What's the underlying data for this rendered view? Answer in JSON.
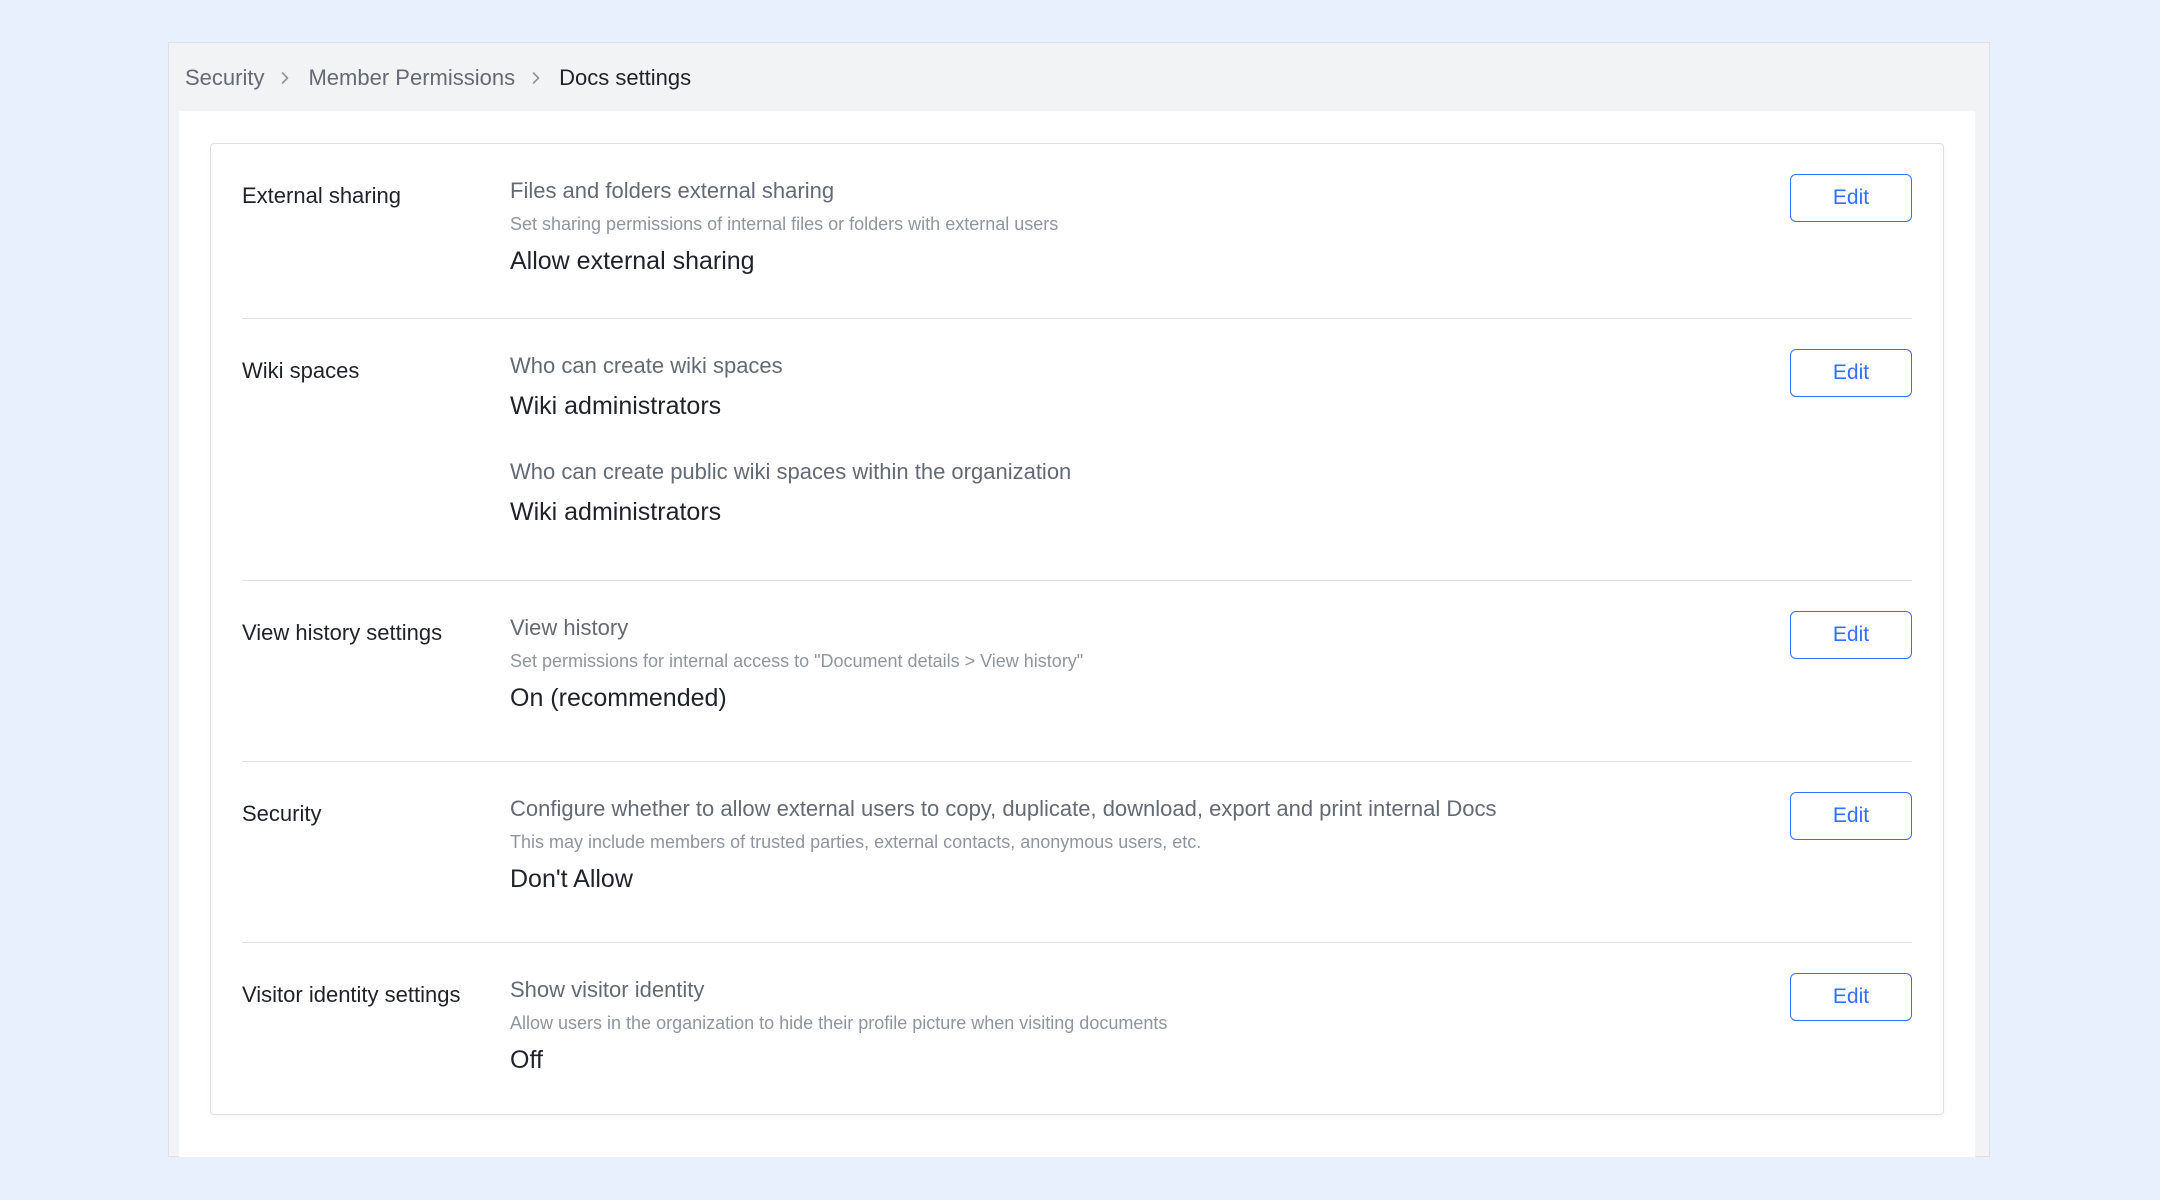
{
  "breadcrumb": {
    "items": [
      "Security",
      "Member Permissions",
      "Docs settings"
    ]
  },
  "sections": [
    {
      "title": "External sharing",
      "items": [
        {
          "label": "Files and folders external sharing",
          "description": "Set sharing permissions of internal files or folders with external users",
          "value": "Allow external sharing"
        }
      ],
      "edit_label": "Edit"
    },
    {
      "title": "Wiki spaces",
      "items": [
        {
          "label": "Who can create wiki spaces",
          "value": "Wiki administrators"
        },
        {
          "label": "Who can create public wiki spaces within the organization",
          "value": "Wiki administrators"
        }
      ],
      "edit_label": "Edit"
    },
    {
      "title": "View history settings",
      "items": [
        {
          "label": "View history",
          "description": "Set permissions for internal access to \"Document details > View history\"",
          "value": "On (recommended)"
        }
      ],
      "edit_label": "Edit"
    },
    {
      "title": "Security",
      "items": [
        {
          "label": "Configure whether to allow external users to copy, duplicate, download, export and print internal Docs",
          "description": "This may include members of trusted parties, external contacts, anonymous users, etc.",
          "value": "Don't Allow"
        }
      ],
      "edit_label": "Edit"
    },
    {
      "title": "Visitor identity settings",
      "items": [
        {
          "label": "Show visitor identity",
          "description": "Allow users in the organization to hide their profile picture when visiting documents",
          "value": "Off"
        }
      ],
      "edit_label": "Edit"
    }
  ],
  "colors": {
    "accent": "#3370ff",
    "page_background": "#e8effd",
    "text_primary": "#1f2329",
    "text_secondary": "#646a73",
    "text_tertiary": "#8f959e",
    "divider": "#dee0e3"
  },
  "icons": {
    "breadcrumb_separator": "chevron-right-icon"
  }
}
